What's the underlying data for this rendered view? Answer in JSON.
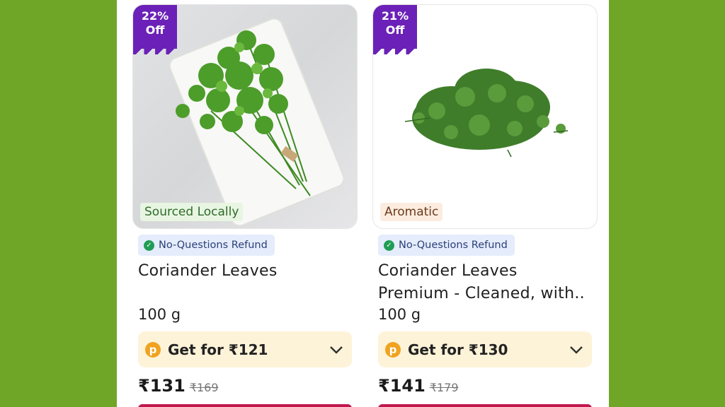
{
  "products": [
    {
      "discount_pct": "22%",
      "discount_label": "Off",
      "tag": "Sourced Locally",
      "refund": "No-Questions Refund",
      "title": "Coriander Leaves",
      "weight": "100 g",
      "offer": "Get for ₹121",
      "price": "₹131",
      "mrp": "₹169"
    },
    {
      "discount_pct": "21%",
      "discount_label": "Off",
      "tag": "Aromatic",
      "refund": "No-Questions Refund",
      "title": "Coriander Leaves Premium - Cleaned, with..",
      "weight": "100 g",
      "offer": "Get for ₹130",
      "price": "₹141",
      "mrp": "₹179"
    }
  ],
  "colors": {
    "background": "#6fa628",
    "discount_badge": "#6b21b8",
    "refund_badge_bg": "#e5ecfb",
    "offer_bg": "#fdf3d8",
    "coin": "#f0a31e",
    "check": "#1f9d55"
  },
  "icons": {
    "check": "check-circle-icon",
    "coin": "coin-p-icon",
    "expand": "chevron-down-icon"
  }
}
